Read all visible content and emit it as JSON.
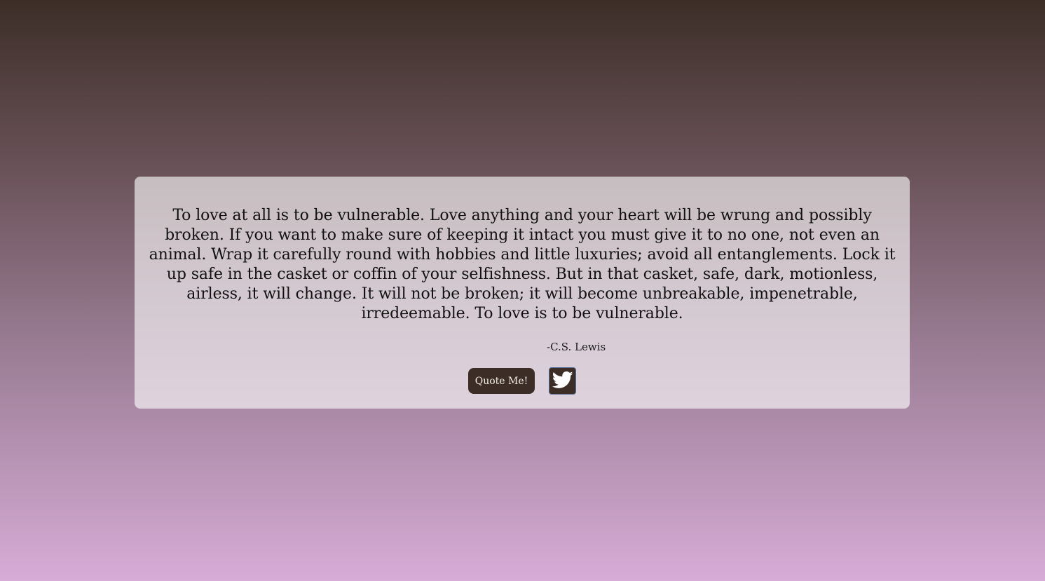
{
  "quote": {
    "text": "To love at all is to be vulnerable. Love anything and your heart will be wrung and possibly broken. If you want to make sure of keeping it intact you must give it to no one, not even an animal. Wrap it carefully round with hobbies and little luxuries; avoid all entanglements. Lock it up safe in the casket or coffin of your selfishness. But in that casket, safe, dark, motionless, airless, it will change. It will not be broken; it will become unbreakable, impenetrable, irredeemable. To love is to be vulnerable.",
    "author": "-C.S. Lewis"
  },
  "actions": {
    "quote_button_label": "Quote Me!",
    "tweet_icon": "twitter-bird-icon"
  },
  "colors": {
    "background_top": "#3c2e27",
    "background_bottom": "#d7acd7",
    "button_bg": "#3c2e27",
    "button_text": "#f4ece6"
  }
}
